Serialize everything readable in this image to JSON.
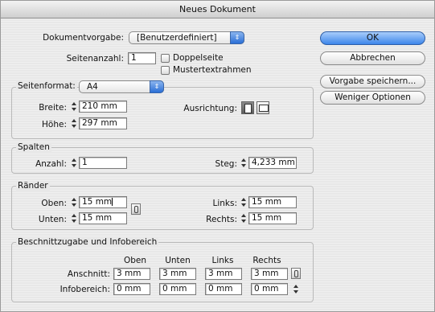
{
  "window": {
    "title": "Neues Dokument"
  },
  "top": {
    "preset_label": "Dokumentvorgabe:",
    "preset_value": "[Benutzerdefiniert]",
    "pages_label": "Seitenanzahl:",
    "pages_value": "1",
    "facing_label": "Doppelseite",
    "master_label": "Mustertextrahmen"
  },
  "buttons": {
    "ok": "OK",
    "cancel": "Abbrechen",
    "save_preset": "Vorgabe speichern...",
    "fewer": "Weniger Optionen"
  },
  "page_size": {
    "label": "Seitenformat:",
    "value": "A4",
    "width_label": "Breite:",
    "width_value": "210 mm",
    "height_label": "Höhe:",
    "height_value": "297 mm",
    "orientation_label": "Ausrichtung:"
  },
  "columns": {
    "title": "Spalten",
    "number_label": "Anzahl:",
    "number_value": "1",
    "gutter_label": "Steg:",
    "gutter_value": "4,233 mm"
  },
  "margins": {
    "title": "Ränder",
    "top_label": "Oben:",
    "top_value": "15 mm",
    "bottom_label": "Unten:",
    "bottom_value": "15 mm",
    "left_label": "Links:",
    "left_value": "15 mm",
    "right_label": "Rechts:",
    "right_value": "15 mm"
  },
  "bleed": {
    "title": "Beschnittzugabe und Infobereich",
    "col_top": "Oben",
    "col_bottom": "Unten",
    "col_left": "Links",
    "col_right": "Rechts",
    "bleed_label": "Anschnitt:",
    "bleed_values": [
      "3 mm",
      "3 mm",
      "3 mm",
      "3 mm"
    ],
    "slug_label": "Infobereich:",
    "slug_values": [
      "0 mm",
      "0 mm",
      "0 mm",
      "0 mm"
    ]
  }
}
